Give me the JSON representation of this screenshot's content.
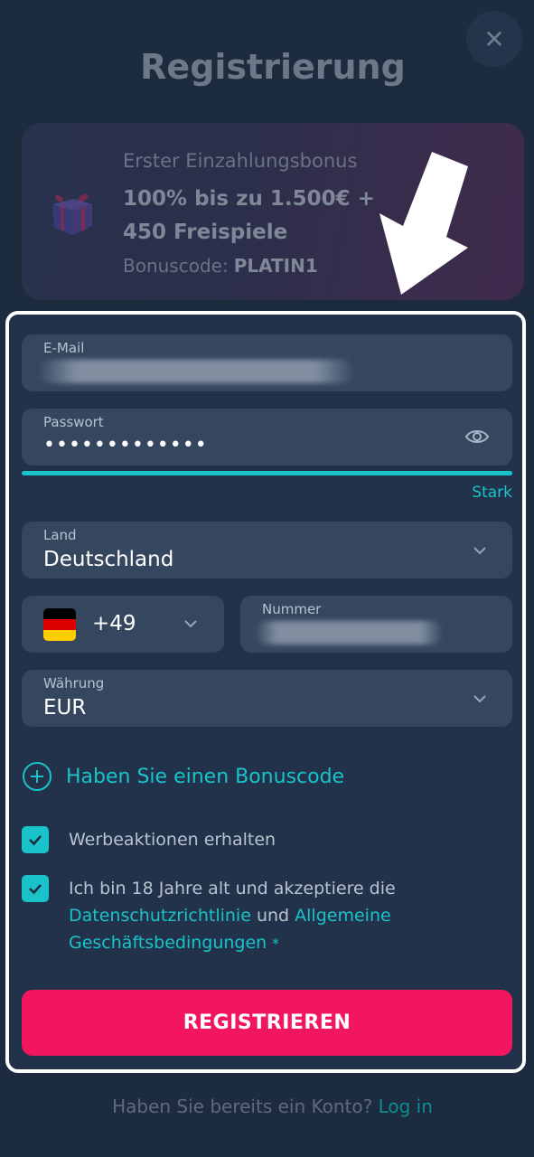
{
  "header": {
    "title": "Registrierung",
    "close_icon": "close-icon"
  },
  "bonus": {
    "heading": "Erster Einzahlungsbonus",
    "offer": "100% bis zu 1.500€ + 450 Freispiele",
    "code_label": "Bonuscode:",
    "code_value": "PLATIN1",
    "icon": "gift-icon"
  },
  "form": {
    "email": {
      "label": "E-Mail",
      "value": ""
    },
    "password": {
      "label": "Passwort",
      "value": "•••••••••••••",
      "strength": "Stark",
      "strength_level": 1.0,
      "icon": "eye-icon"
    },
    "country": {
      "label": "Land",
      "value": "Deutschland"
    },
    "phone": {
      "code": "+49",
      "flag": "germany-flag",
      "label": "Nummer",
      "value": ""
    },
    "currency": {
      "label": "Währung",
      "value": "EUR"
    },
    "promo": {
      "label": "Haben Sie einen Bonuscode",
      "icon": "plus-circle-icon"
    },
    "checkboxes": [
      {
        "label": "Werbeaktionen erhalten",
        "checked": true
      },
      {
        "text_before": "Ich bin 18 Jahre alt und akzeptiere die",
        "link1": "Datenschutzrichtlinie",
        "joiner": "und",
        "link2": "Allgemeine Geschäftsbedingungen",
        "suffix": "*",
        "checked": true
      }
    ],
    "submit_label": "REGISTRIEREN"
  },
  "footer": {
    "question": "Haben Sie bereits ein Konto?",
    "login_label": "Log in"
  },
  "colors": {
    "background": "#1d2b3f",
    "field": "#35475f",
    "accent": "#19c3c9",
    "primary_button": "#f21661"
  }
}
